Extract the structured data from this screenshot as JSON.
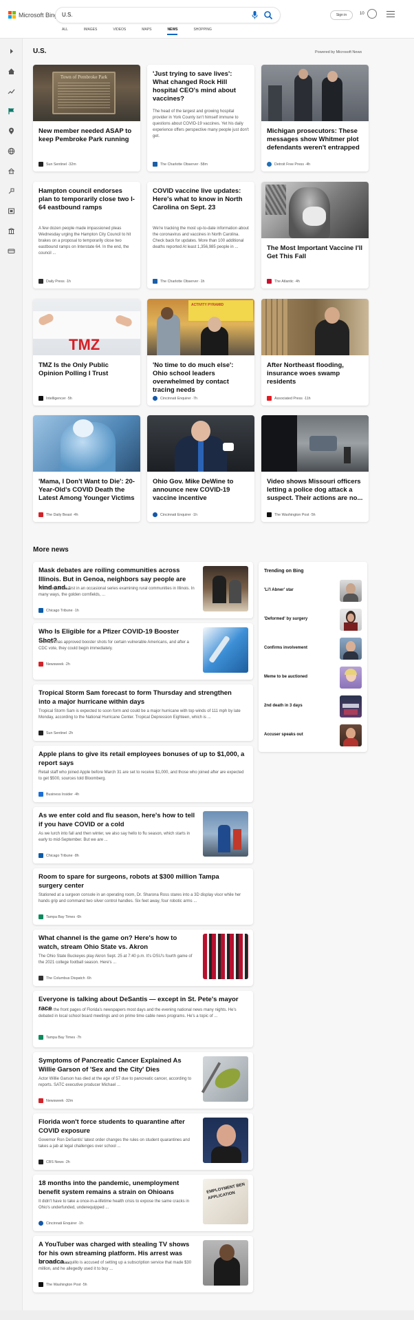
{
  "header": {
    "brand": "Microsoft Bing",
    "query": "U.S.",
    "sign_in": "Sign in",
    "rewards": "10"
  },
  "tabs": [
    {
      "label": "ALL"
    },
    {
      "label": "IMAGES"
    },
    {
      "label": "VIDEOS"
    },
    {
      "label": "MAPS"
    },
    {
      "label": "NEWS"
    },
    {
      "label": "SHOPPING"
    }
  ],
  "section": {
    "title": "U.S.",
    "powered": "Powered by Microsoft News"
  },
  "cards": [
    {
      "headline": "New member needed ASAP to keep Pembroke Park running",
      "desc": "",
      "source": "Sun Sentinel",
      "time": "32m",
      "img_text": "Town of Pembroke Park"
    },
    {
      "headline": "'Just trying to save lives': What changed Rock Hill hospital CEO's mind about vaccines?",
      "desc": "The head of the largest and growing hospital provider in York County isn't himself immune to questions about COVID-19 vaccines. Yet his daily experience offers perspective many people just don't get.",
      "source": "The Charlotte Observer",
      "time": "58m"
    },
    {
      "headline": "Michigan prosecutors: These messages show Whitmer plot defendants weren't entrapped",
      "desc": "",
      "source": "Detroit Free Press",
      "time": "4h"
    },
    {
      "headline": "Hampton council endorses plan to temporarily close two I-64 eastbound ramps",
      "desc": "A few dozen people made impassioned pleas Wednesday urging the Hampton City Council to hit brakes on a proposal to temporarily close two eastbound ramps on Interstate 64. In the end, the council ...",
      "source": "Daily Press",
      "time": "1h"
    },
    {
      "headline": "COVID vaccine live updates: Here's what to know in North Carolina on Sept. 23",
      "desc": "We're tracking the most up-to-date information about the coronavirus and vaccines in North Carolina. Check back for updates. More than 100 additional deaths reported At least 1,356,985 people in ...",
      "source": "The Charlotte Observer",
      "time": "1h"
    },
    {
      "headline": "The Most Important Vaccine I'll Get This Fall",
      "desc": "",
      "source": "The Atlantic",
      "time": "4h"
    },
    {
      "headline": "TMZ Is the Only Public Opinion Polling I Trust",
      "desc": "",
      "source": "Intelligencer",
      "time": "5h",
      "img_text": "TMZ"
    },
    {
      "headline": "'No time to do much else': Ohio school leaders overwhelmed by contact tracing needs",
      "desc": "",
      "source": "Cincinnati Enquirer",
      "time": "7h",
      "img_text": "ACTIVITY PYRAMID"
    },
    {
      "headline": "After Northeast flooding, insurance woes swamp residents",
      "desc": "",
      "source": "Associated Press",
      "time": "11h"
    },
    {
      "headline": "'Mama, I Don't Want to Die': 20-Year-Old's COVID Death the Latest Among Younger Victims",
      "desc": "",
      "source": "The Daily Beast",
      "time": "4h"
    },
    {
      "headline": "Ohio Gov. Mike DeWine to announce new COVID-19 vaccine incentive",
      "desc": "",
      "source": "Cincinnati Enquirer",
      "time": "1h"
    },
    {
      "headline": "Video shows Missouri officers letting a police dog attack a suspect. Their actions are no...",
      "desc": "",
      "source": "The Washington Post",
      "time": "5h"
    }
  ],
  "more_news": {
    "title": "More news",
    "items": [
      {
        "headline": "Mask debates are roiling communities across Illinois. But in Genoa, neighbors say people are kind and...",
        "desc": "This story is the first in an occasional series examining rural communities in Illinois. In many ways, the golden cornfields, ...",
        "source": "Chicago Tribune",
        "time": "1h"
      },
      {
        "headline": "Who Is Eligible for a Pfizer COVID-19 Booster Shot?",
        "desc": "The FDA has approved booster shots for certain vulnerable Americans, and after a CDC vote, they could begin immediately.",
        "source": "Newsweek",
        "time": "2h"
      },
      {
        "headline": "Tropical Storm Sam forecast to form Thursday and strengthen into a major hurricane within days",
        "desc": "Tropical Storm Sam is expected to soon form and could be a major hurricane with top winds of 111 mph by late Monday, according to the National Hurricane Center. Tropical Depression Eighteen, which is ...",
        "source": "Sun Sentinel",
        "time": "2h"
      },
      {
        "headline": "Apple plans to give its retail employees bonuses of up to $1,000, a report says",
        "desc": "Retail staff who joined Apple before March 31 are set to receive $1,000, and those who joined after are expected to get $500, sources told Bloomberg.",
        "source": "Business Insider",
        "time": "4h"
      },
      {
        "headline": "As we enter cold and flu season, here's how to tell if you have COVID or a cold",
        "desc": "As we lurch into fall and then winter, we also say hello to flu season, which starts in early to mid-September. But we are ...",
        "source": "Chicago Tribune",
        "time": "8h"
      },
      {
        "headline": "Room to spare for surgeons, robots at $300 million Tampa surgery center",
        "desc": "Stationed at a surgeon console in an operating room, Dr. Sharona Ross stares into a 3D display visor while her hands grip and command two silver control handles. Six feet away, four robotic arms ...",
        "source": "Tampa Bay Times",
        "time": "6h"
      },
      {
        "headline": "What channel is the game on? Here's how to watch, stream Ohio State vs. Akron",
        "desc": "The Ohio State Buckeyes play Akron Sept. 25 at 7:40 p.m. It's OSU's fourth game of the 2021 college football season. Here's ...",
        "source": "The Columbus Dispatch",
        "time": "6h"
      },
      {
        "headline": "Everyone is talking about DeSantis — except in St. Pete's mayor race",
        "desc": "He's on the front pages of Florida's newspapers most days and the evening national news many nights. He's debated in local school board meetings and on prime time cable news programs. He's a topic of ...",
        "source": "Tampa Bay Times",
        "time": "7h"
      },
      {
        "headline": "Symptoms of Pancreatic Cancer Explained As Willie Garson of 'Sex and the City' Dies",
        "desc": "Actor Willie Garson has died at the age of 57 due to pancreatic cancer, according to reports. SATC executive producer Michael ...",
        "source": "Newsweek",
        "time": "32m"
      },
      {
        "headline": "Florida won't force students to quarantine after COVID exposure",
        "desc": "Governor Ron DeSantis' latest order changes the rules on student quarantines and takes a jab at legal challenges over school ...",
        "source": "CBS News",
        "time": "2h"
      },
      {
        "headline": "18 months into the pandemic, unemployment benefit system remains a strain on Ohioans",
        "desc": "It didn't have to take a once-in-a-lifetime health crisis to expose the same cracks in Ohio's underfunded, underequipped ...",
        "source": "Cincinnati Enquirer",
        "time": "1h",
        "img_text": "EMPLOYMENT BEN APPLICATION"
      },
      {
        "headline": "A YouTuber was charged with stealing TV shows for his own streaming platform. His arrest was broadca...",
        "desc": "Bill Omar Carrasquillo is accused of setting up a subscription service that made $30 million, and he allegedly used it to buy ...",
        "source": "The Washington Post",
        "time": "5h"
      }
    ]
  },
  "trending": {
    "title": "Trending on Bing",
    "items": [
      {
        "label": "'Li'l Abner' star"
      },
      {
        "label": "'Deformed' by surgery"
      },
      {
        "label": "Confirms involvement"
      },
      {
        "label": "Meme to be auctioned"
      },
      {
        "label": "2nd death in 3 days"
      },
      {
        "label": "Accuser speaks out"
      }
    ]
  },
  "colors": {
    "accent": "#0a66c2",
    "brand_red": "#f25022",
    "brand_green": "#7fba00",
    "brand_blue": "#00a4ef",
    "brand_yellow": "#ffb900"
  }
}
